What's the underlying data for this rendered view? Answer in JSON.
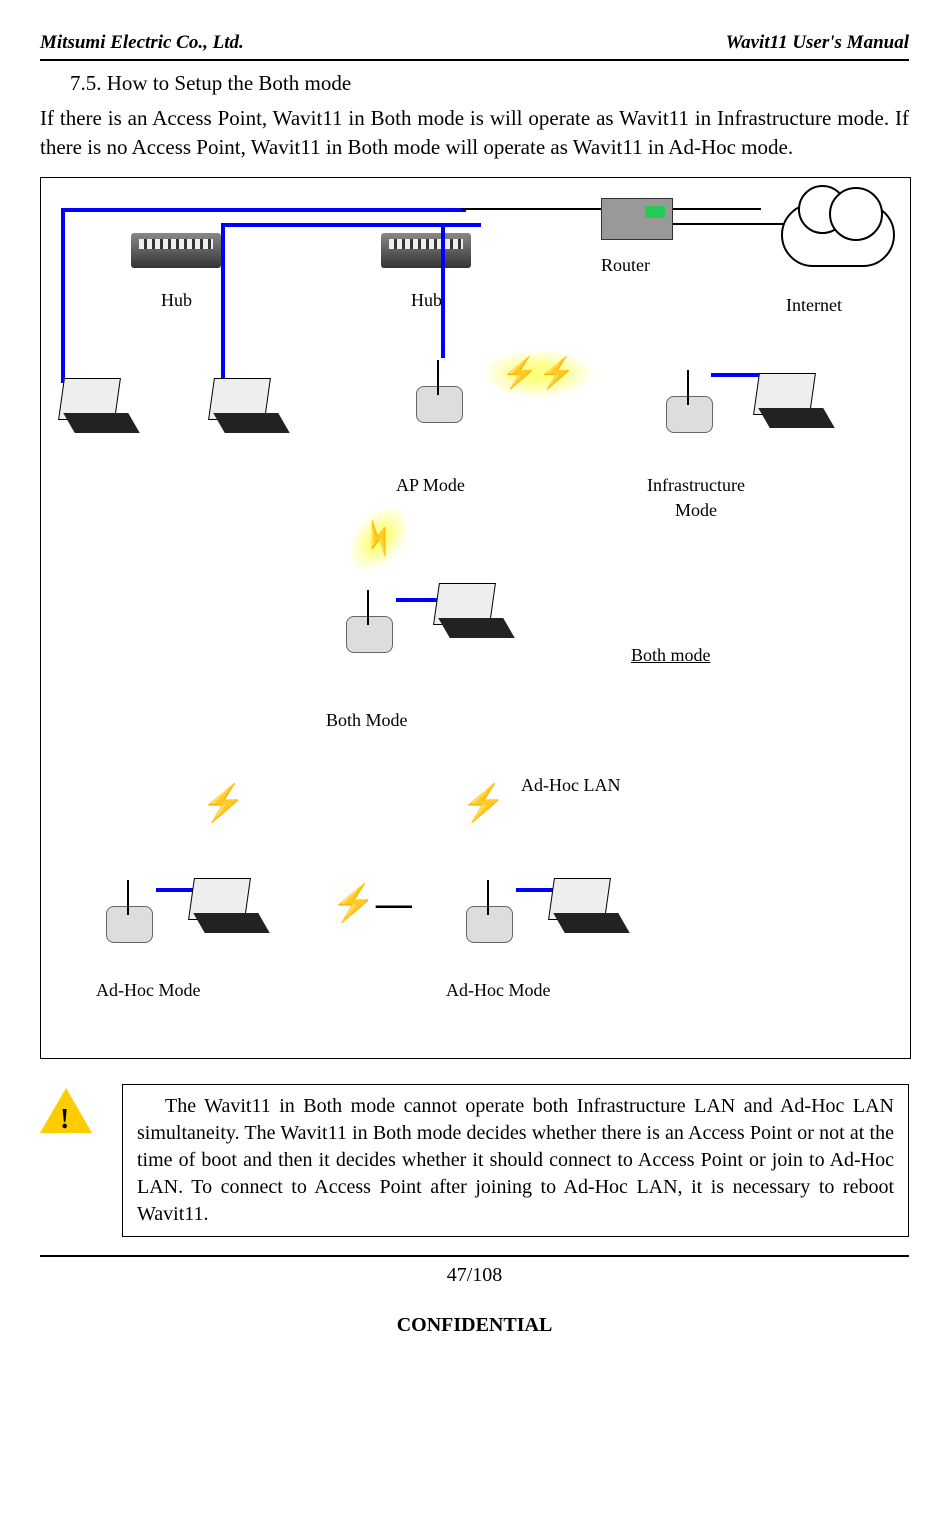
{
  "header": {
    "left": "Mitsumi Electric Co., Ltd.",
    "right": "Wavit11 User's Manual"
  },
  "section": {
    "heading": "7.5. How to Setup the Both mode"
  },
  "body": "If there is an Access Point, Wavit11 in Both mode is will operate as Wavit11 in Infrastructure mode. If there is no Access Point, Wavit11 in Both mode will operate as Wavit11 in Ad-Hoc mode.",
  "diagram": {
    "hub1": "Hub",
    "hub2": "Hub",
    "router": "Router",
    "internet": "Internet",
    "ap_mode": "AP Mode",
    "infra_mode_l1": "Infrastructure",
    "infra_mode_l2": "Mode",
    "both_mode_big": "Both Mode",
    "both_mode_u": "Both mode",
    "adhoc_lan": "Ad-Hoc LAN",
    "adhoc_mode_l": "Ad-Hoc Mode",
    "adhoc_mode_r": "Ad-Hoc Mode"
  },
  "warning": "The Wavit11 in Both mode cannot operate both Infrastructure LAN and Ad-Hoc LAN simultaneity. The Wavit11 in Both mode decides whether there is an Access Point or not at the time of boot and then it decides whether it should connect to Access Point or   join to Ad-Hoc LAN. To connect to Access Point after joining to Ad-Hoc LAN, it is necessary to reboot Wavit11.",
  "page_number": "47/108",
  "confidential": "CONFIDENTIAL"
}
